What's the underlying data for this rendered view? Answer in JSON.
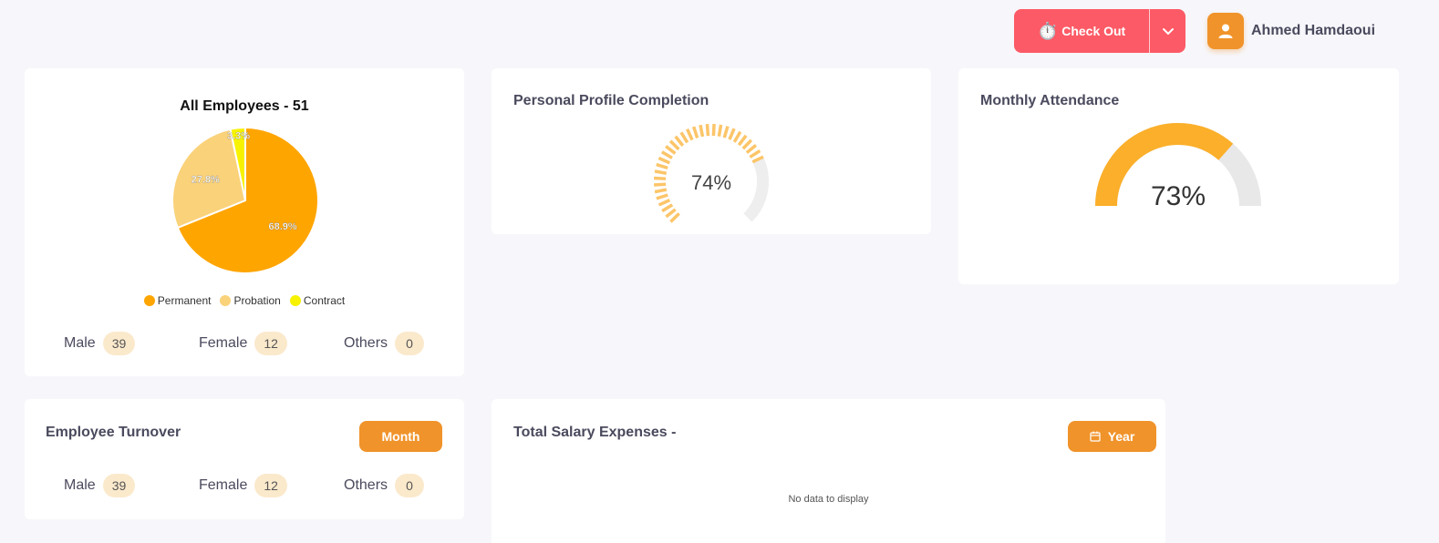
{
  "header": {
    "checkout_label": "Check Out",
    "user_name": "Ahmed Hamdaoui"
  },
  "employees_card": {
    "title": "All Employees - 51",
    "legend": [
      {
        "label": "Permanent",
        "color": "#ffa500"
      },
      {
        "label": "Probation",
        "color": "#fad27a"
      },
      {
        "label": "Contract",
        "color": "#f7f200"
      }
    ],
    "gender": {
      "male_label": "Male",
      "male_count": "39",
      "female_label": "Female",
      "female_count": "12",
      "others_label": "Others",
      "others_count": "0"
    }
  },
  "chart_data": [
    {
      "type": "pie",
      "title": "All Employees - 51",
      "categories": [
        "Permanent",
        "Probation",
        "Contract"
      ],
      "values": [
        68.9,
        27.8,
        3.3
      ],
      "labels": [
        "68.9%",
        "27.8%",
        "3.3%"
      ],
      "colors": [
        "#ffa500",
        "#fad27a",
        "#f7f200"
      ],
      "legend": "bottom"
    }
  ],
  "profile_card": {
    "title": "Personal Profile Completion",
    "value_label": "74%",
    "value": 0.74,
    "colors": {
      "fill": "#fcc569",
      "track": "#eeeeee"
    }
  },
  "attendance_card": {
    "title": "Monthly Attendance",
    "value_label": "73%",
    "value": 0.73,
    "colors": {
      "fill": "#fbaf2a",
      "track": "#e8e8e8"
    }
  },
  "turnover_card": {
    "title": "Employee Turnover",
    "period_button": "Month",
    "gender": {
      "male_label": "Male",
      "male_count": "39",
      "female_label": "Female",
      "female_count": "12",
      "others_label": "Others",
      "others_count": "0"
    }
  },
  "salary_card": {
    "title": "Total Salary Expenses -",
    "period_button": "Year",
    "empty_text": "No data to display"
  },
  "colors": {
    "accent": "#f0932a",
    "checkout": "#fc5a66",
    "badge": "#fbe9cc"
  }
}
